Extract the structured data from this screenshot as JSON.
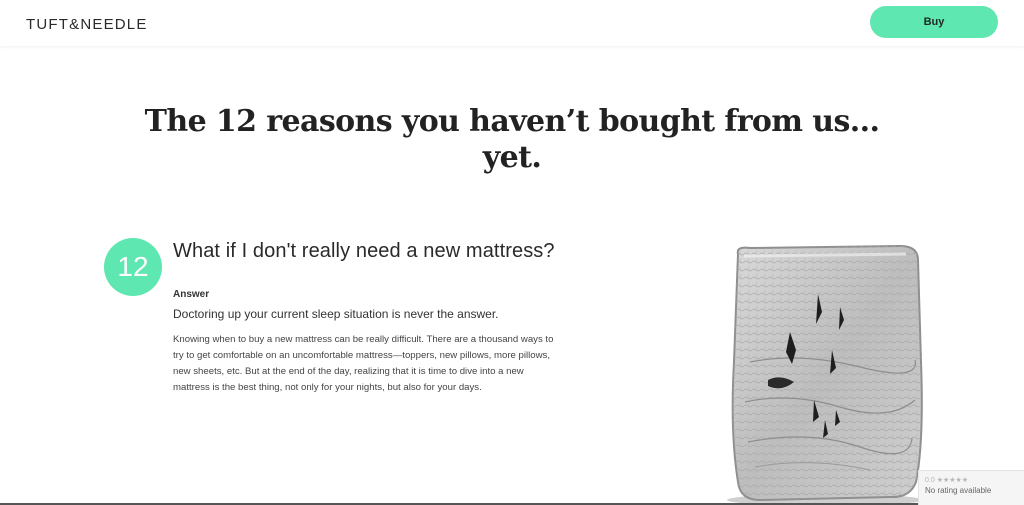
{
  "header": {
    "logo_text": "TUFT&NEEDLE",
    "buy_label": "Buy"
  },
  "hero": {
    "title_line1": "The 12 reasons you haven’t bought from us...",
    "title_line2": "yet."
  },
  "item": {
    "number": "12",
    "question": "What if I don't really need a new mattress?",
    "answer_label": "Answer",
    "answer_lead": "Doctoring up your current sleep situation is never the answer.",
    "answer_body": "Knowing when to buy a new mattress can be really difficult. There are a thousand ways to try to get comfortable on an uncomfortable mattress—toppers, new pillows, more pillows, new sheets, etc. But at the end of the day, realizing that it is time to dive into a new mattress is the best thing, not only for your nights, but also for your days."
  },
  "rating": {
    "score": "0.0",
    "stars": "★★★★★",
    "text": "No rating available"
  },
  "colors": {
    "accent": "#5ee7b0",
    "text": "#222222"
  }
}
